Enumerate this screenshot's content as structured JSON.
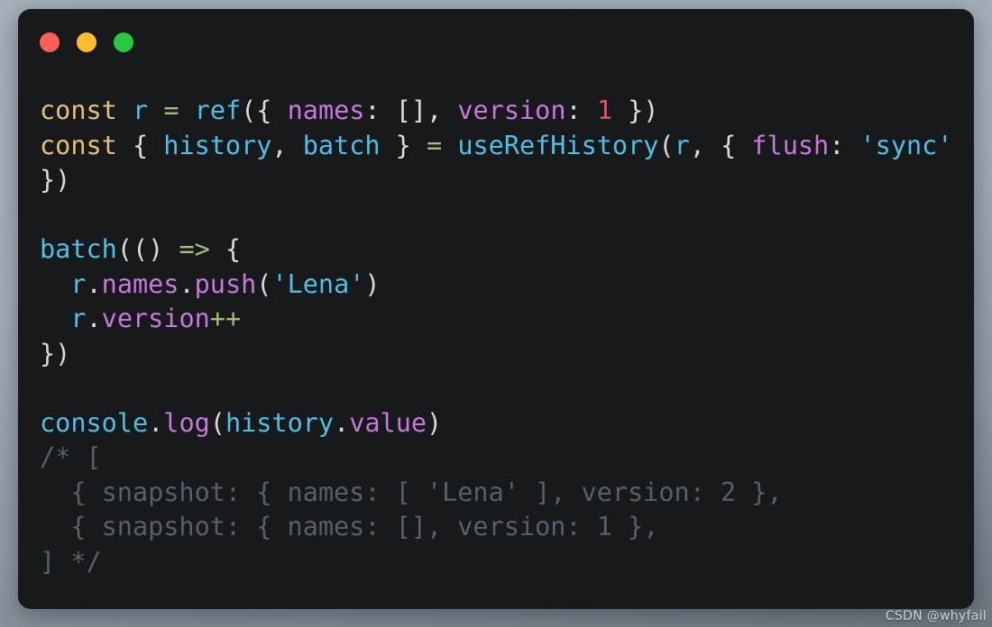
{
  "window": {
    "controls": [
      {
        "name": "close",
        "color": "#ff5f56"
      },
      {
        "name": "minimize",
        "color": "#febc2e"
      },
      {
        "name": "maximize",
        "color": "#28c840"
      }
    ]
  },
  "theme": {
    "card_background": "#18191b",
    "page_background_top": "#a6b0bb",
    "page_background_bottom": "#6e7880",
    "keyword": "#e5c07b",
    "identifier": "#4ec0e8",
    "property": "#c678dd",
    "number": "#e05561",
    "string": "#4ec0e8",
    "operator": "#98c379",
    "punctuation": "#d7dae0",
    "comment": "#55606d"
  },
  "code": {
    "language": "javascript",
    "plain_text": "const r = ref({ names: [], version: 1 })\nconst { history, batch } = useRefHistory(r, { flush: 'sync'\n})\n\nbatch(() => {\n  r.names.push('Lena')\n  r.version++\n})\n\nconsole.log(history.value)\n/* [\n  { snapshot: { names: [ 'Lena' ], version: 2 },\n  { snapshot: { names: [], version: 1 },\n] */",
    "lines": [
      {
        "id": "line-1",
        "tokens": [
          {
            "text": "const",
            "type": "kw"
          },
          {
            "text": " ",
            "type": "punc"
          },
          {
            "text": "r",
            "type": "ident"
          },
          {
            "text": " ",
            "type": "punc"
          },
          {
            "text": "=",
            "type": "op"
          },
          {
            "text": " ",
            "type": "punc"
          },
          {
            "text": "ref",
            "type": "fn"
          },
          {
            "text": "({ ",
            "type": "punc"
          },
          {
            "text": "names",
            "type": "prop"
          },
          {
            "text": ": [], ",
            "type": "punc"
          },
          {
            "text": "version",
            "type": "prop"
          },
          {
            "text": ": ",
            "type": "punc"
          },
          {
            "text": "1",
            "type": "num"
          },
          {
            "text": " })",
            "type": "punc"
          }
        ]
      },
      {
        "id": "line-2",
        "tokens": [
          {
            "text": "const",
            "type": "kw"
          },
          {
            "text": " { ",
            "type": "punc"
          },
          {
            "text": "history",
            "type": "ident"
          },
          {
            "text": ", ",
            "type": "punc"
          },
          {
            "text": "batch",
            "type": "ident"
          },
          {
            "text": " } ",
            "type": "punc"
          },
          {
            "text": "=",
            "type": "op"
          },
          {
            "text": " ",
            "type": "punc"
          },
          {
            "text": "useRefHistory",
            "type": "fn"
          },
          {
            "text": "(",
            "type": "punc"
          },
          {
            "text": "r",
            "type": "ident"
          },
          {
            "text": ", { ",
            "type": "punc"
          },
          {
            "text": "flush",
            "type": "prop"
          },
          {
            "text": ": ",
            "type": "punc"
          },
          {
            "text": "'sync'",
            "type": "str"
          }
        ]
      },
      {
        "id": "line-3",
        "tokens": [
          {
            "text": "})",
            "type": "punc"
          }
        ]
      },
      {
        "id": "line-4",
        "tokens": []
      },
      {
        "id": "line-5",
        "tokens": [
          {
            "text": "batch",
            "type": "fn"
          },
          {
            "text": "(() ",
            "type": "punc"
          },
          {
            "text": "=>",
            "type": "op"
          },
          {
            "text": " {",
            "type": "punc"
          }
        ]
      },
      {
        "id": "line-6",
        "tokens": [
          {
            "text": "  ",
            "type": "punc"
          },
          {
            "text": "r",
            "type": "ident"
          },
          {
            "text": ".",
            "type": "punc"
          },
          {
            "text": "names",
            "type": "prop"
          },
          {
            "text": ".",
            "type": "punc"
          },
          {
            "text": "push",
            "type": "prop"
          },
          {
            "text": "(",
            "type": "punc"
          },
          {
            "text": "'Lena'",
            "type": "str"
          },
          {
            "text": ")",
            "type": "punc"
          }
        ]
      },
      {
        "id": "line-7",
        "tokens": [
          {
            "text": "  ",
            "type": "punc"
          },
          {
            "text": "r",
            "type": "ident"
          },
          {
            "text": ".",
            "type": "punc"
          },
          {
            "text": "version",
            "type": "prop"
          },
          {
            "text": "++",
            "type": "op"
          }
        ]
      },
      {
        "id": "line-8",
        "tokens": [
          {
            "text": "})",
            "type": "punc"
          }
        ]
      },
      {
        "id": "line-9",
        "tokens": []
      },
      {
        "id": "line-10",
        "tokens": [
          {
            "text": "console",
            "type": "ident"
          },
          {
            "text": ".",
            "type": "punc"
          },
          {
            "text": "log",
            "type": "prop"
          },
          {
            "text": "(",
            "type": "punc"
          },
          {
            "text": "history",
            "type": "ident"
          },
          {
            "text": ".",
            "type": "punc"
          },
          {
            "text": "value",
            "type": "prop"
          },
          {
            "text": ")",
            "type": "punc"
          }
        ]
      },
      {
        "id": "line-11",
        "tokens": [
          {
            "text": "/* [",
            "type": "comment"
          }
        ]
      },
      {
        "id": "line-12",
        "tokens": [
          {
            "text": "  { snapshot: { names: [ 'Lena' ], version: 2 },",
            "type": "comment"
          }
        ]
      },
      {
        "id": "line-13",
        "tokens": [
          {
            "text": "  { snapshot: { names: [], version: 1 },",
            "type": "comment"
          }
        ]
      },
      {
        "id": "line-14",
        "tokens": [
          {
            "text": "] */",
            "type": "comment"
          }
        ]
      }
    ]
  },
  "watermark": {
    "text": "CSDN @whyfail"
  }
}
